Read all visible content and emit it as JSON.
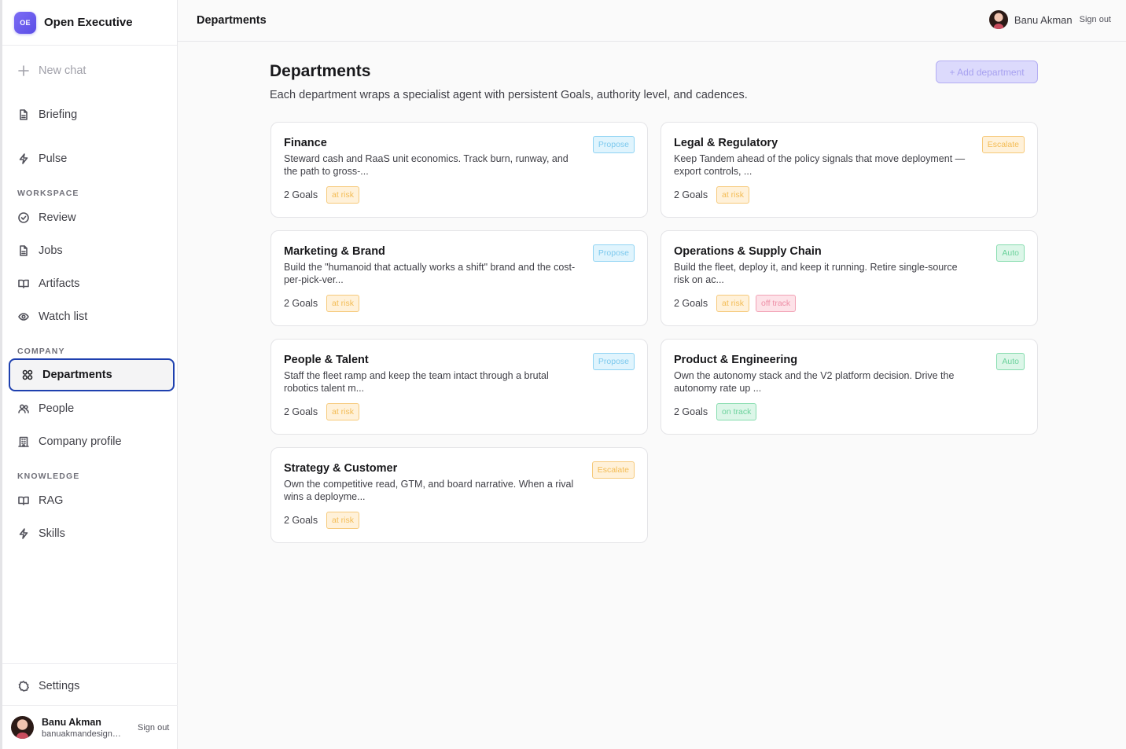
{
  "app": {
    "logo_text": "OE",
    "name": "Open Executive"
  },
  "sidebar": {
    "new_chat": "New chat",
    "top_items": [
      {
        "label": "Briefing",
        "icon": "document-icon"
      },
      {
        "label": "Pulse",
        "icon": "bolt-icon"
      }
    ],
    "sections": [
      {
        "title": "WORKSPACE",
        "items": [
          {
            "label": "Review",
            "icon": "check-circle-icon"
          },
          {
            "label": "Jobs",
            "icon": "document-icon"
          },
          {
            "label": "Artifacts",
            "icon": "book-icon"
          },
          {
            "label": "Watch list",
            "icon": "eye-icon"
          }
        ]
      },
      {
        "title": "COMPANY",
        "items": [
          {
            "label": "Departments",
            "icon": "grid-icon",
            "active": true
          },
          {
            "label": "People",
            "icon": "users-icon"
          },
          {
            "label": "Company profile",
            "icon": "building-icon"
          }
        ]
      },
      {
        "title": "KNOWLEDGE",
        "items": [
          {
            "label": "RAG",
            "icon": "book-icon"
          },
          {
            "label": "Skills",
            "icon": "bolt-icon"
          }
        ]
      }
    ],
    "settings": "Settings",
    "user": {
      "name": "Banu Akman",
      "email": "banuakmandesign@g...",
      "sign_out": "Sign out"
    }
  },
  "topbar": {
    "title": "Departments",
    "user_name": "Banu Akman",
    "sign_out": "Sign out"
  },
  "main": {
    "title": "Departments",
    "subtitle": "Each department wraps a specialist agent with persistent Goals, authority level, and cadences.",
    "add_button": "+ Add department"
  },
  "departments": [
    {
      "name": "Finance",
      "desc": "Steward cash and RaaS unit economics. Track burn, runway, and the path to gross-...",
      "authority": "Propose",
      "goals": "2 Goals",
      "statuses": [
        "at risk"
      ]
    },
    {
      "name": "Legal & Regulatory",
      "desc": "Keep Tandem ahead of the policy signals that move deployment — export controls, ...",
      "authority": "Escalate",
      "goals": "2 Goals",
      "statuses": [
        "at risk"
      ]
    },
    {
      "name": "Marketing & Brand",
      "desc": "Build the \"humanoid that actually works a shift\" brand and the cost-per-pick-ver...",
      "authority": "Propose",
      "goals": "2 Goals",
      "statuses": [
        "at risk"
      ]
    },
    {
      "name": "Operations & Supply Chain",
      "desc": "Build the fleet, deploy it, and keep it running. Retire single-source risk on ac...",
      "authority": "Auto",
      "goals": "2 Goals",
      "statuses": [
        "at risk",
        "off track"
      ]
    },
    {
      "name": "People & Talent",
      "desc": "Staff the fleet ramp and keep the team intact through a brutal robotics talent m...",
      "authority": "Propose",
      "goals": "2 Goals",
      "statuses": [
        "at risk"
      ]
    },
    {
      "name": "Product & Engineering",
      "desc": "Own the autonomy stack and the V2 platform decision. Drive the autonomy rate up ...",
      "authority": "Auto",
      "goals": "2 Goals",
      "statuses": [
        "on track"
      ]
    },
    {
      "name": "Strategy & Customer",
      "desc": "Own the competitive read, GTM, and board narrative. When a rival wins a deployme...",
      "authority": "Escalate",
      "goals": "2 Goals",
      "statuses": [
        "at risk"
      ]
    }
  ]
}
